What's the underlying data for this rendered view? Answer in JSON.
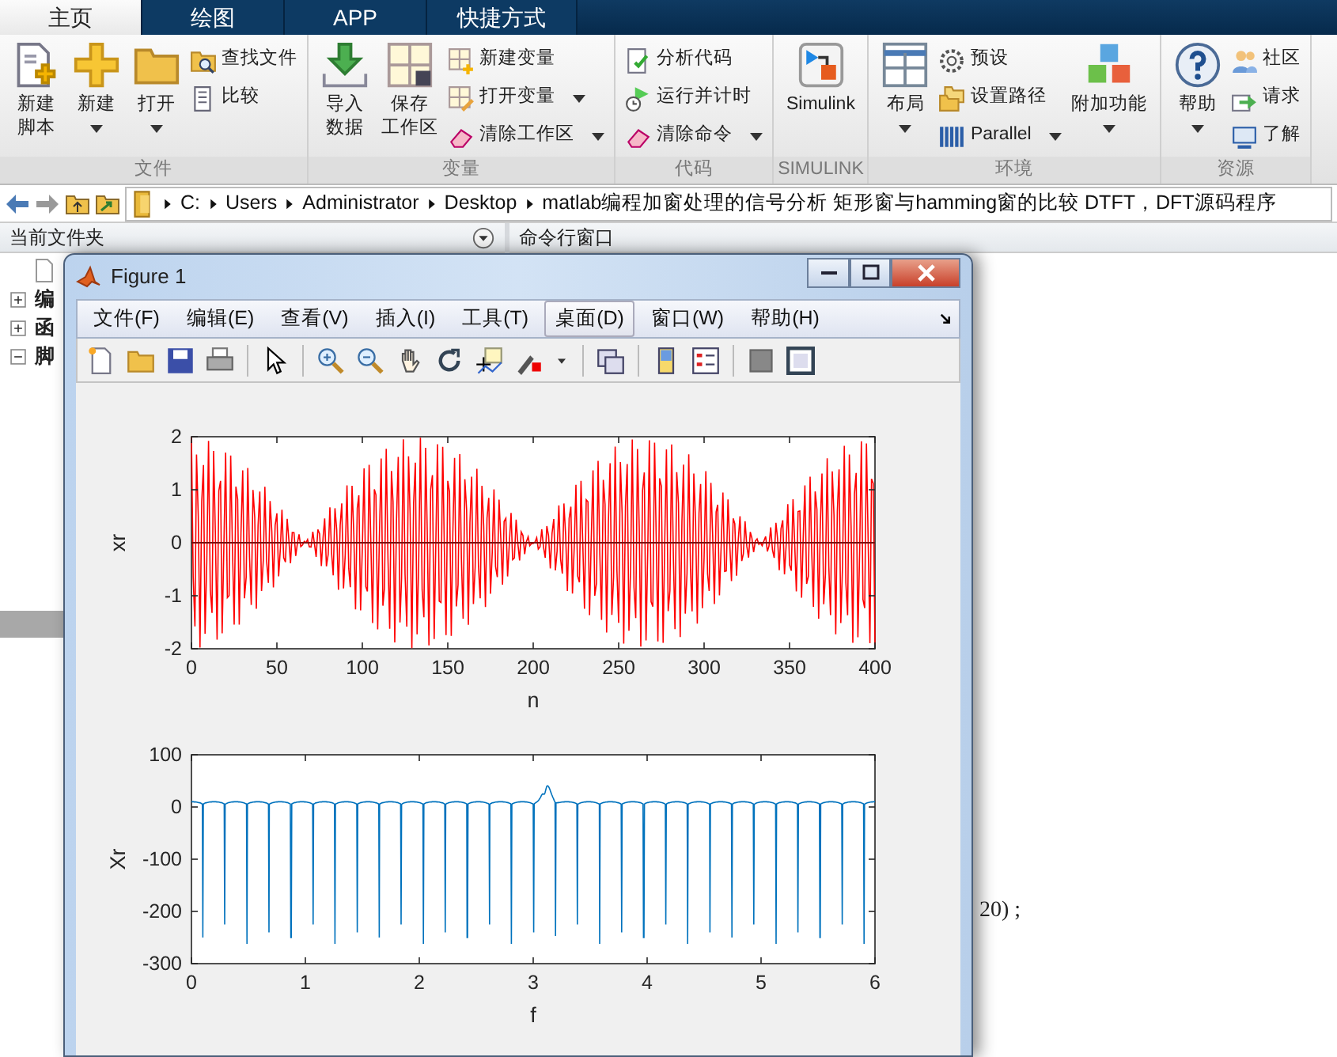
{
  "tabs": [
    {
      "label": "主页",
      "selected": true
    },
    {
      "label": "绘图",
      "selected": false
    },
    {
      "label": "APP",
      "selected": false
    },
    {
      "label": "快捷方式",
      "selected": false
    }
  ],
  "toolstrip": [
    {
      "label": "文件",
      "items": [
        {
          "kind": "large",
          "lines": [
            "新建",
            "脚本"
          ],
          "dropdown": false
        },
        {
          "kind": "large",
          "lines": [
            "新建"
          ],
          "dropdown": true
        },
        {
          "kind": "large",
          "lines": [
            "打开"
          ],
          "dropdown": true
        },
        {
          "kind": "small",
          "lines": [
            "查找文件"
          ],
          "dropdown": false
        },
        {
          "kind": "small",
          "lines": [
            "比较"
          ],
          "dropdown": false
        }
      ]
    },
    {
      "label": "变量",
      "items": [
        {
          "kind": "large",
          "lines": [
            "导入",
            "数据"
          ],
          "dropdown": false
        },
        {
          "kind": "large",
          "lines": [
            "保存",
            "工作区"
          ],
          "dropdown": false
        },
        {
          "kind": "small",
          "lines": [
            "新建变量"
          ],
          "dropdown": false
        },
        {
          "kind": "small",
          "lines": [
            "打开变量"
          ],
          "dropdown": true
        },
        {
          "kind": "small",
          "lines": [
            "清除工作区"
          ],
          "dropdown": true
        }
      ]
    },
    {
      "label": "代码",
      "items": [
        {
          "kind": "small",
          "lines": [
            "分析代码"
          ],
          "dropdown": false
        },
        {
          "kind": "small",
          "lines": [
            "运行并计时"
          ],
          "dropdown": false
        },
        {
          "kind": "small",
          "lines": [
            "清除命令"
          ],
          "dropdown": true
        }
      ]
    },
    {
      "label": "SIMULINK",
      "items": [
        {
          "kind": "large",
          "lines": [
            "Simulink"
          ],
          "dropdown": false
        }
      ]
    },
    {
      "label": "环境",
      "items": [
        {
          "kind": "large",
          "lines": [
            "布局"
          ],
          "dropdown": true
        },
        {
          "kind": "small",
          "lines": [
            "预设"
          ],
          "dropdown": false
        },
        {
          "kind": "small",
          "lines": [
            "设置路径"
          ],
          "dropdown": false
        },
        {
          "kind": "small",
          "lines": [
            "Parallel"
          ],
          "dropdown": true
        },
        {
          "kind": "large",
          "lines": [
            "附加功能"
          ],
          "dropdown": true
        }
      ]
    },
    {
      "label": "资源",
      "items": [
        {
          "kind": "large",
          "lines": [
            "帮助"
          ],
          "dropdown": true
        },
        {
          "kind": "small",
          "lines": [
            "社区"
          ],
          "dropdown": false
        },
        {
          "kind": "small",
          "lines": [
            "请求"
          ],
          "dropdown": false
        },
        {
          "kind": "small",
          "lines": [
            "了解"
          ],
          "dropdown": false
        }
      ]
    }
  ],
  "address_bar": {
    "segments": [
      "C:",
      "Users",
      "Administrator",
      "Desktop",
      "matlab编程加窗处理的信号分析 矩形窗与hamming窗的比较 DTFT，DFT源码程序"
    ]
  },
  "current_folder": {
    "title": "当前文件夹",
    "tree": [
      {
        "label": "编",
        "expanded": false
      },
      {
        "label": "函",
        "expanded": false
      },
      {
        "label": "脚",
        "expanded": true
      }
    ]
  },
  "command_window": {
    "title": "命令行窗口",
    "lines": [
      "20) ;"
    ]
  },
  "figure": {
    "title": "Figure 1",
    "menu": [
      {
        "label": "文件(F)",
        "selected": false
      },
      {
        "label": "编辑(E)",
        "selected": false
      },
      {
        "label": "查看(V)",
        "selected": false
      },
      {
        "label": "插入(I)",
        "selected": false
      },
      {
        "label": "工具(T)",
        "selected": false
      },
      {
        "label": "桌面(D)",
        "selected": true
      },
      {
        "label": "窗口(W)",
        "selected": false
      },
      {
        "label": "帮助(H)",
        "selected": false
      }
    ],
    "axes": [
      {
        "xlabel": "n",
        "ylabel": "xr",
        "xtick_labels": [
          "0",
          "50",
          "100",
          "150",
          "200",
          "250",
          "300",
          "350",
          "400"
        ],
        "ytick_labels": [
          "2",
          "1",
          "0",
          "-1",
          "-2"
        ]
      },
      {
        "xlabel": "f",
        "ylabel": "Xr",
        "xtick_labels": [
          "0",
          "1",
          "2",
          "3",
          "4",
          "5",
          "6"
        ],
        "ytick_labels": [
          "100",
          "0",
          "-100",
          "-200",
          "-300"
        ]
      }
    ]
  }
}
